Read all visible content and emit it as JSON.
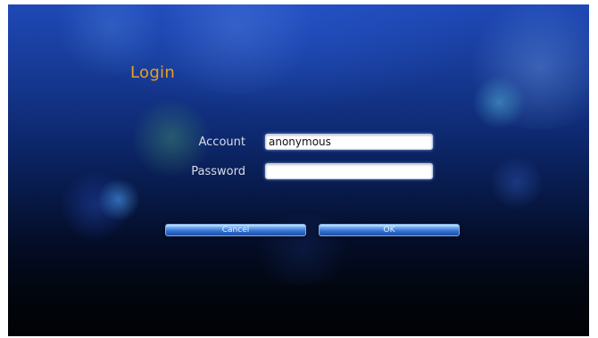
{
  "login": {
    "title": "Login",
    "account_label": "Account",
    "account_value": "anonymous",
    "password_label": "Password",
    "password_value": "",
    "cancel_label": "Cancel",
    "ok_label": "OK"
  },
  "colors": {
    "title": "#e8a020",
    "label": "#d8dde8",
    "background_top": "#1f49b6",
    "background_bottom": "#010205",
    "button": "#2f6fd0"
  }
}
